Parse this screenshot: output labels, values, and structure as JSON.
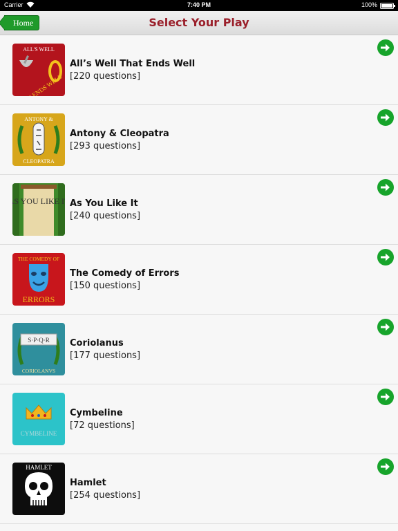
{
  "status_bar": {
    "carrier": "Carrier",
    "time": "7:40 PM",
    "battery": "100%"
  },
  "nav": {
    "home_label": "Home",
    "title": "Select Your Play"
  },
  "plays": [
    {
      "title": "All’s Well That Ends Well",
      "count": "[220 questions]",
      "thumb_text_top": "ALL'S WELL",
      "thumb_text_bottom": "THAT ENDS WELL"
    },
    {
      "title": "Antony & Cleopatra",
      "count": "[293 questions]",
      "thumb_text_top": "ANTONY &",
      "thumb_text_bottom": "CLEOPATRA"
    },
    {
      "title": "As You Like It",
      "count": "[240 questions]",
      "thumb_text_top": "AS YOU LIKE IT",
      "thumb_text_bottom": ""
    },
    {
      "title": "The Comedy of Errors",
      "count": "[150 questions]",
      "thumb_text_top": "THE COMEDY OF",
      "thumb_text_bottom": "ERRORS"
    },
    {
      "title": "Coriolanus",
      "count": "[177 questions]",
      "thumb_text_top": "S·P·Q·R",
      "thumb_text_bottom": "CORIOLANVS"
    },
    {
      "title": "Cymbeline",
      "count": "[72 questions]",
      "thumb_text_top": "",
      "thumb_text_bottom": "CYMBELINE"
    },
    {
      "title": "Hamlet",
      "count": "[254 questions]",
      "thumb_text_top": "HAMLET",
      "thumb_text_bottom": ""
    }
  ],
  "colors": {
    "title_red": "#9a1f2a",
    "go_green": "#17a42b",
    "home_green": "#1f9a2a"
  }
}
